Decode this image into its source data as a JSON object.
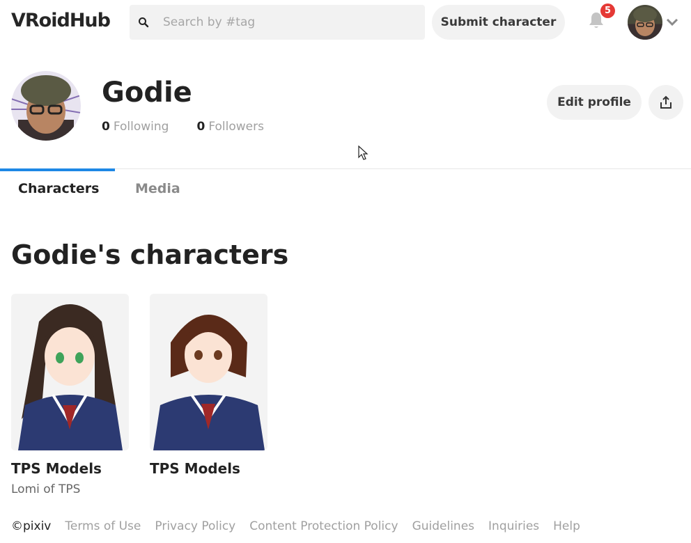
{
  "header": {
    "logo_text": "VRoidHub",
    "search_placeholder": "Search by #tag",
    "submit_label": "Submit character",
    "notification_count": "5"
  },
  "profile": {
    "name": "Godie",
    "following_count": "0",
    "following_label": "Following",
    "followers_count": "0",
    "followers_label": "Followers",
    "edit_label": "Edit profile"
  },
  "tabs": [
    {
      "label": "Characters",
      "active": true
    },
    {
      "label": "Media",
      "active": false
    }
  ],
  "section": {
    "title": "Godie's characters"
  },
  "characters": [
    {
      "title": "TPS Models",
      "subtitle": "Lomi of TPS"
    },
    {
      "title": "TPS Models",
      "subtitle": ""
    }
  ],
  "footer": {
    "copyright": "©pixiv",
    "links": [
      "Terms of Use",
      "Privacy Policy",
      "Content Protection Policy",
      "Guidelines",
      "Inquiries",
      "Help"
    ]
  },
  "colors": {
    "accent": "#1e88e5",
    "badge": "#e53935",
    "button_bg": "#f2f2f2"
  },
  "icons": [
    "search-icon",
    "bell-icon",
    "chevron-down-icon",
    "share-icon"
  ]
}
